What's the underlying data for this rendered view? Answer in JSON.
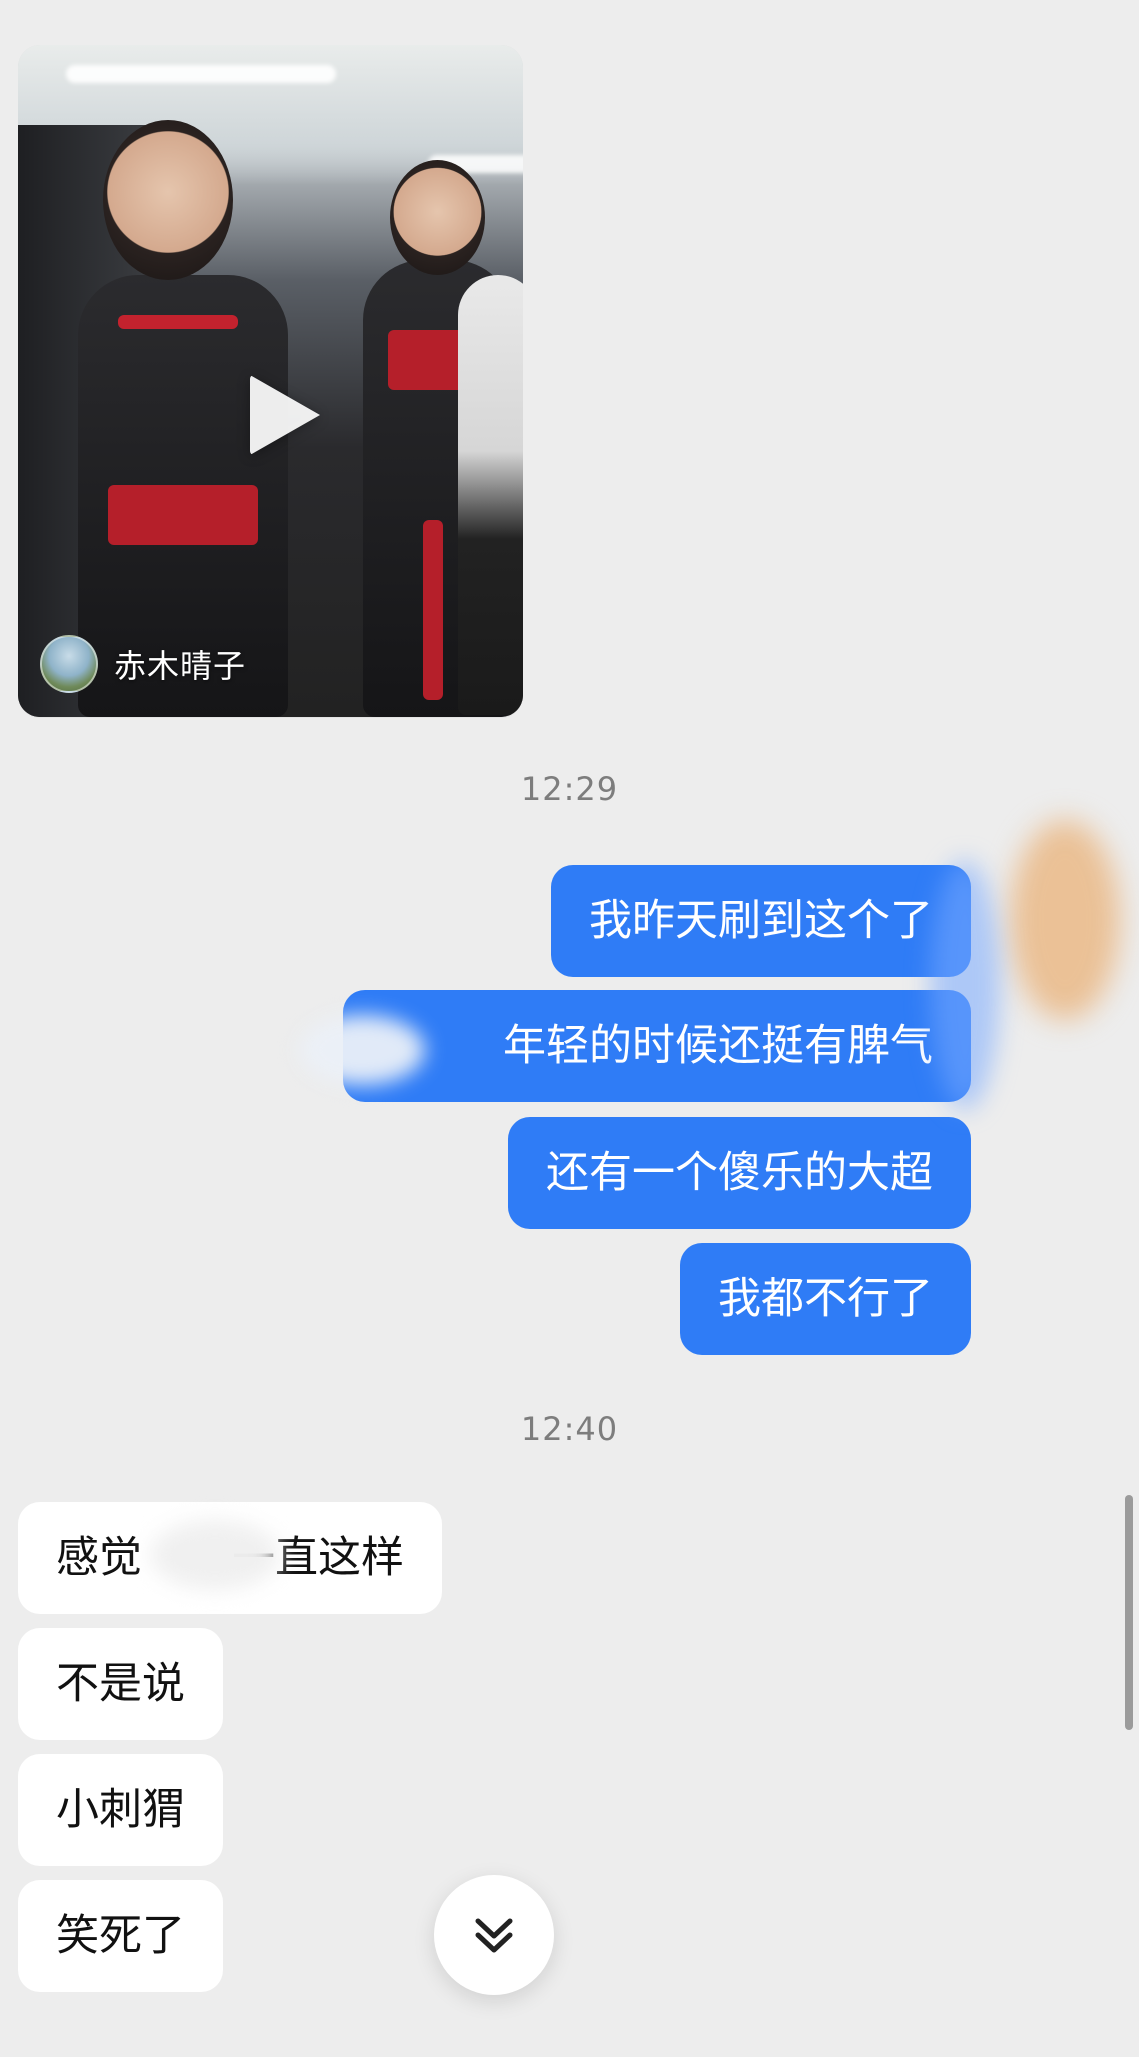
{
  "shared_video": {
    "author_name": "赤木晴子",
    "play_icon": "play-icon",
    "avatar_icon": "avatar"
  },
  "timestamps": [
    "12:29",
    "12:40"
  ],
  "sent_messages": [
    "我昨天刷到这个了",
    "年轻的时候还挺有脾气",
    "还有一个傻乐的大超",
    "我都不行了"
  ],
  "received_messages": [
    "感觉一直这样",
    "不是说",
    "小刺猬",
    "笑死了"
  ],
  "received_message_1_parts": {
    "before_blur": "感觉",
    "after_blur": "一直这样"
  },
  "sent_message_2_prefix_blurred": true,
  "colors": {
    "background": "#ededed",
    "sent_bubble": "#2f7cf6",
    "received_bubble": "#ffffff",
    "timestamp_text": "#7d7d7d"
  },
  "scroll_button_icon": "double-chevron-down-icon"
}
